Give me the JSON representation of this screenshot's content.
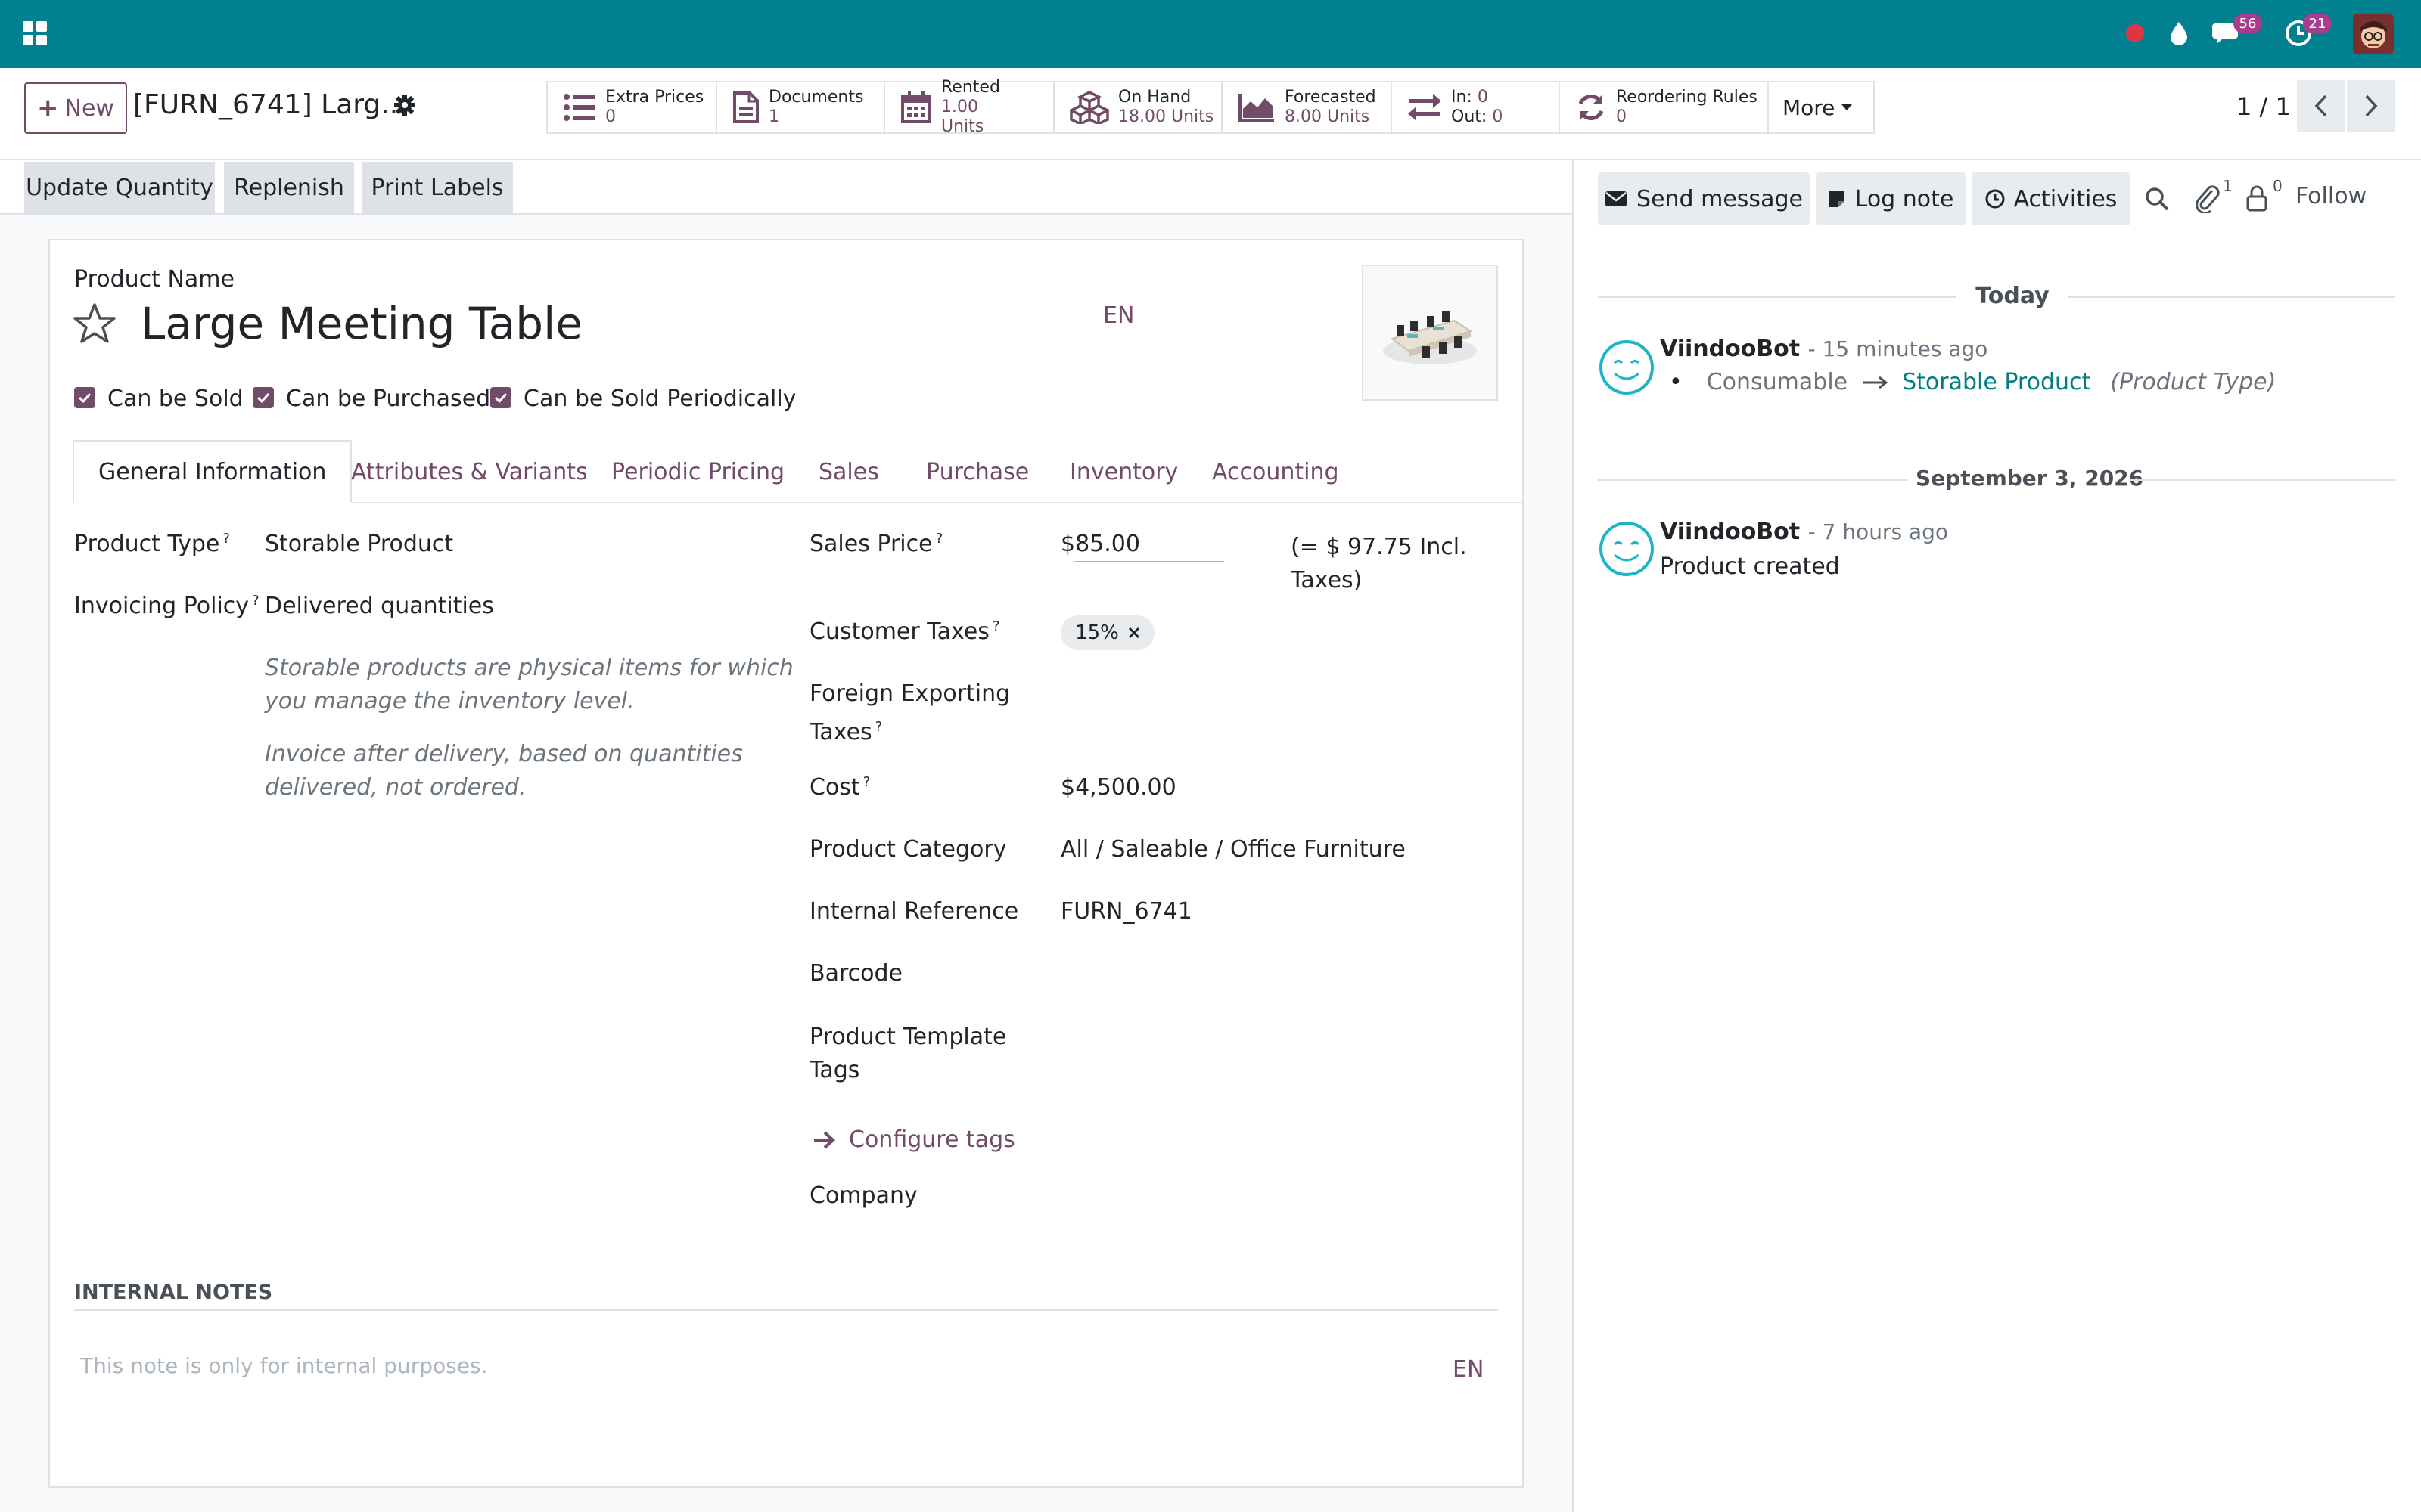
{
  "navbar": {
    "messages_badge": "56",
    "activities_badge": "21"
  },
  "control": {
    "new_label": "New",
    "breadcrumb": "[FURN_6741] Larg...",
    "smart_buttons": [
      {
        "title": "Extra Prices",
        "value": "0",
        "icon": "list-icon"
      },
      {
        "title": "Documents",
        "value": "1",
        "icon": "document-icon"
      },
      {
        "title": "Rented",
        "value": "1.00",
        "value2": "Units",
        "icon": "calendar-icon"
      },
      {
        "title": "On Hand",
        "value": "18.00 Units",
        "icon": "cubes-icon"
      },
      {
        "title": "Forecasted",
        "value": "8.00 Units",
        "icon": "area-chart-icon"
      },
      {
        "in_label": "In:",
        "in_value": "0",
        "out_label": "Out:",
        "out_value": "0",
        "icon": "exchange-icon"
      },
      {
        "title": "Reordering Rules",
        "value": "0",
        "icon": "refresh-icon"
      }
    ],
    "more_label": "More",
    "pager": "1 / 1"
  },
  "statusbar": {
    "update_quantity": "Update Quantity",
    "replenish": "Replenish",
    "print_labels": "Print Labels"
  },
  "form": {
    "product_name_label": "Product Name",
    "product_name": "Large Meeting Table",
    "lang": "EN",
    "can_be_sold": "Can be Sold",
    "can_be_purchased": "Can be Purchased",
    "can_be_sold_periodically": "Can be Sold Periodically",
    "tabs": [
      "General Information",
      "Attributes & Variants",
      "Periodic Pricing",
      "Sales",
      "Purchase",
      "Inventory",
      "Accounting"
    ],
    "product_type_label": "Product Type",
    "product_type": "Storable Product",
    "invoicing_policy_label": "Invoicing Policy",
    "invoicing_policy": "Delivered quantities",
    "help1_line1": "Storable products are physical items for which",
    "help1_line2": "you manage the inventory level.",
    "help2_line1": "Invoice after delivery, based on quantities",
    "help2_line2": "delivered, not ordered.",
    "sales_price_label": "Sales Price",
    "sales_price": "$85.00",
    "incl_taxes_line1": "(= $ 97.75 Incl.",
    "incl_taxes_line2": "Taxes)",
    "customer_taxes_label": "Customer Taxes",
    "customer_tax": "15%",
    "foreign_taxes_line1": "Foreign Exporting",
    "foreign_taxes_line2": "Taxes",
    "cost_label": "Cost",
    "cost": "$4,500.00",
    "category_label": "Product Category",
    "category": "All / Saleable / Office Furniture",
    "internal_ref_label": "Internal Reference",
    "internal_ref": "FURN_6741",
    "barcode_label": "Barcode",
    "tags_label_line1": "Product Template",
    "tags_label_line2": "Tags",
    "configure_tags": "Configure tags",
    "company_label": "Company",
    "internal_notes_title": "INTERNAL NOTES",
    "notes_placeholder": "This note is only for internal purposes.",
    "notes_lang": "EN",
    "help_mark": "?"
  },
  "chatter": {
    "send_message": "Send message",
    "log_note": "Log note",
    "activities": "Activities",
    "attachments_count": "1",
    "followers_count": "0",
    "follow": "Follow",
    "sep_today": "Today",
    "sep_date": "September 3, 2026",
    "messages": [
      {
        "author": "ViindooBot",
        "time": "- 15 minutes ago",
        "old": "Consumable",
        "new": "Storable Product",
        "field": "(Product Type)"
      },
      {
        "author": "ViindooBot",
        "time": "- 7 hours ago",
        "body": "Product created"
      }
    ]
  },
  "colors": {
    "navbar": "#01808f",
    "brand": "#714b67",
    "link_blue": "#017e84",
    "avatar_teal": "#1ab6c7",
    "status_red": "#dc3545"
  }
}
